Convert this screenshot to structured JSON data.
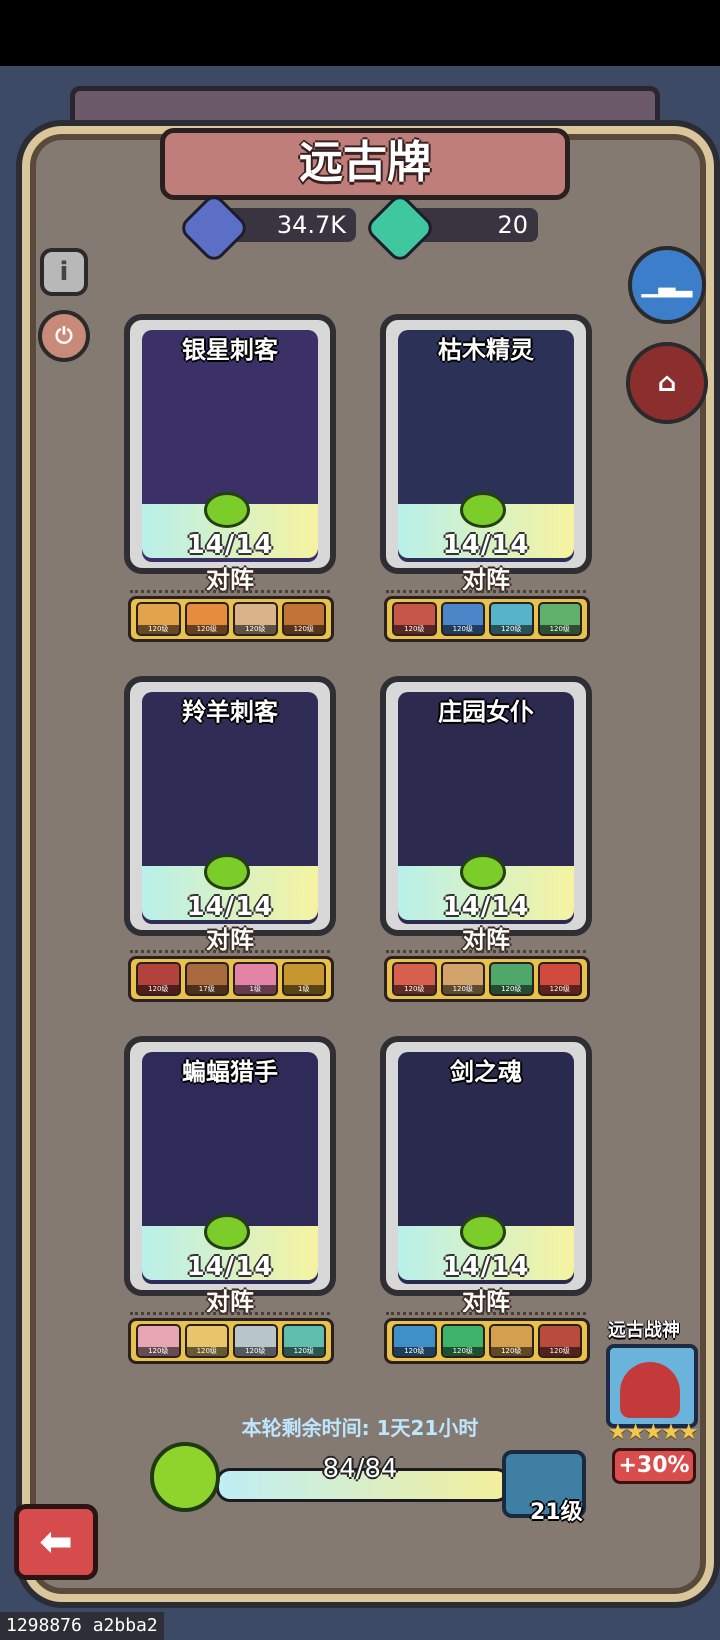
{
  "title": "远古牌",
  "currency": {
    "crystal_amount": "34.7K",
    "green_amount": "20"
  },
  "cards": [
    {
      "name": "银星刺客",
      "count": "14/14",
      "lineup_label": "对阵",
      "art_color": "#3b3166",
      "heroes": [
        {
          "lvl": "120级",
          "c": "#e2a34a"
        },
        {
          "lvl": "120级",
          "c": "#e78c3e"
        },
        {
          "lvl": "120级",
          "c": "#d9b48a"
        },
        {
          "lvl": "120级",
          "c": "#c27436"
        }
      ]
    },
    {
      "name": "枯木精灵",
      "count": "14/14",
      "lineup_label": "对阵",
      "art_color": "#2c3158",
      "heroes": [
        {
          "lvl": "120级",
          "c": "#c8554a"
        },
        {
          "lvl": "120级",
          "c": "#4a86c8"
        },
        {
          "lvl": "120级",
          "c": "#57b3c9"
        },
        {
          "lvl": "120级",
          "c": "#5fb06a"
        }
      ]
    },
    {
      "name": "羚羊刺客",
      "count": "14/14",
      "lineup_label": "对阵",
      "art_color": "#2f2c56",
      "heroes": [
        {
          "lvl": "120级",
          "c": "#b2423c"
        },
        {
          "lvl": "17级",
          "c": "#a86a3e"
        },
        {
          "lvl": "1级",
          "c": "#e383a6"
        },
        {
          "lvl": "1级",
          "c": "#c8962e"
        }
      ]
    },
    {
      "name": "庄园女仆",
      "count": "14/14",
      "lineup_label": "对阵",
      "art_color": "#2d2a50",
      "heroes": [
        {
          "lvl": "120级",
          "c": "#d8604e"
        },
        {
          "lvl": "120级",
          "c": "#d2a46c"
        },
        {
          "lvl": "120级",
          "c": "#4fa86a"
        },
        {
          "lvl": "120级",
          "c": "#d04a3e"
        }
      ]
    },
    {
      "name": "蝙蝠猎手",
      "count": "14/14",
      "lineup_label": "对阵",
      "art_color": "#2e2b58",
      "heroes": [
        {
          "lvl": "120级",
          "c": "#e6a6b4"
        },
        {
          "lvl": "120级",
          "c": "#e8c46a"
        },
        {
          "lvl": "120级",
          "c": "#b8c6cc"
        },
        {
          "lvl": "120级",
          "c": "#5fbfae"
        }
      ]
    },
    {
      "name": "剑之魂",
      "count": "14/14",
      "lineup_label": "对阵",
      "art_color": "#2a2a4e",
      "heroes": [
        {
          "lvl": "120级",
          "c": "#3f8fc9"
        },
        {
          "lvl": "120级",
          "c": "#3fb36a"
        },
        {
          "lvl": "120级",
          "c": "#d4a04e"
        },
        {
          "lvl": "120级",
          "c": "#b84a3e"
        }
      ]
    }
  ],
  "timer_text": "本轮剩余时间: 1天21小时",
  "progress": {
    "text": "84/84",
    "fraction": 1.0
  },
  "level_text": "21级",
  "ancient_god": {
    "name": "远古战神",
    "stars": "★★★★★",
    "bonus": "+30%"
  },
  "footer_id": "1298876 a2bba2"
}
